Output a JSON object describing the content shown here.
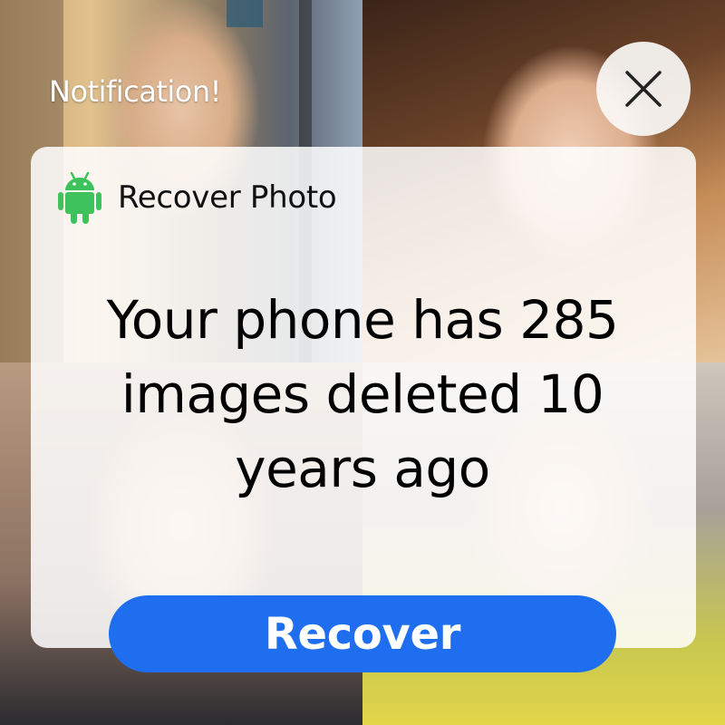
{
  "notification": {
    "title": "Notification!"
  },
  "app": {
    "name": "Recover Photo",
    "icon": "android-icon",
    "icon_color": "#3ec25b"
  },
  "message": {
    "line1": "Your phone has 285",
    "line2": "images deleted 10",
    "line3": "years ago"
  },
  "actions": {
    "recover_label": "Recover",
    "recover_color": "#1f6ef0",
    "close_icon": "close-icon"
  }
}
